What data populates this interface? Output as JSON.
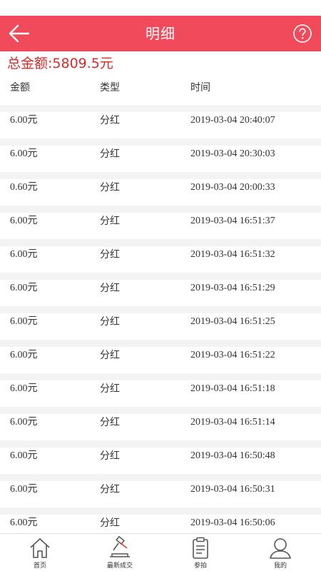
{
  "header": {
    "title": "明细",
    "back_icon": "back-arrow-icon",
    "help_icon": "question-circle-icon",
    "bg_color": "#f14a5a"
  },
  "summary": {
    "total_text": "总金额:5809.5元",
    "color": "#d92a2a"
  },
  "columns": {
    "amount": "金额",
    "type": "类型",
    "time": "时间"
  },
  "rows": [
    {
      "amount": "6.00元",
      "type": "分红",
      "time": "2019-03-04 20:40:07"
    },
    {
      "amount": "6.00元",
      "type": "分红",
      "time": "2019-03-04 20:30:03"
    },
    {
      "amount": "0.60元",
      "type": "分红",
      "time": "2019-03-04 20:00:33"
    },
    {
      "amount": "6.00元",
      "type": "分红",
      "time": "2019-03-04 16:51:37"
    },
    {
      "amount": "6.00元",
      "type": "分红",
      "time": "2019-03-04 16:51:32"
    },
    {
      "amount": "6.00元",
      "type": "分红",
      "time": "2019-03-04 16:51:29"
    },
    {
      "amount": "6.00元",
      "type": "分红",
      "time": "2019-03-04 16:51:25"
    },
    {
      "amount": "6.00元",
      "type": "分红",
      "time": "2019-03-04 16:51:22"
    },
    {
      "amount": "6.00元",
      "type": "分红",
      "time": "2019-03-04 16:51:18"
    },
    {
      "amount": "6.00元",
      "type": "分红",
      "time": "2019-03-04 16:51:14"
    },
    {
      "amount": "6.00元",
      "type": "分红",
      "time": "2019-03-04 16:50:48"
    },
    {
      "amount": "6.00元",
      "type": "分红",
      "time": "2019-03-04 16:50:31"
    },
    {
      "amount": "6.00元",
      "type": "分红",
      "time": "2019-03-04 16:50:06"
    }
  ],
  "tabbar": {
    "items": [
      {
        "label": "首页",
        "icon": "home-icon"
      },
      {
        "label": "最新成交",
        "icon": "auction-gavel-icon"
      },
      {
        "label": "参拍",
        "icon": "clipboard-icon"
      },
      {
        "label": "我的",
        "icon": "user-icon"
      }
    ]
  }
}
